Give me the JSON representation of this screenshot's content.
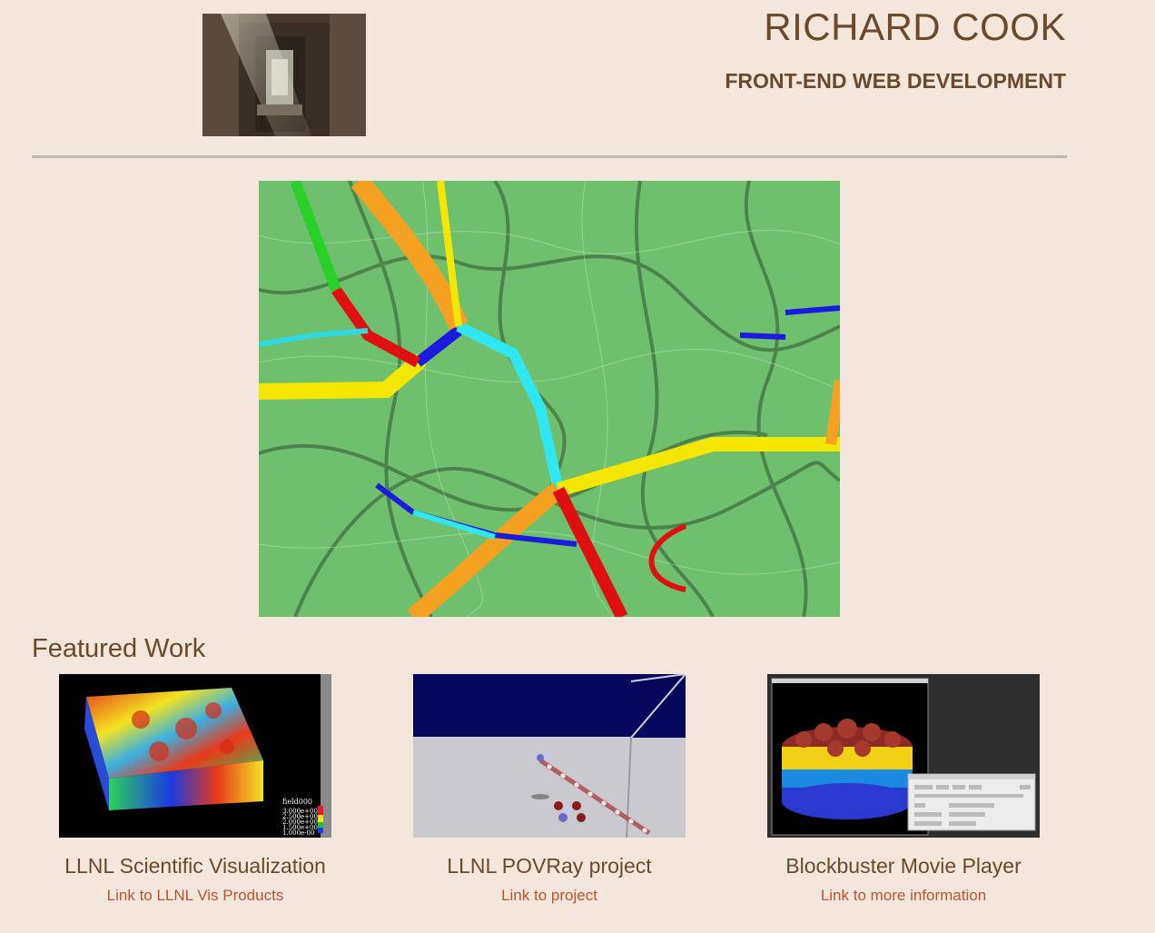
{
  "header": {
    "name": "RICHARD COOK",
    "subtitle": "FRONT-END WEB DEVELOPMENT"
  },
  "featured": {
    "heading": "Featured Work",
    "items": [
      {
        "title": "LLNL Scientific Visualization",
        "link": "Link to LLNL Vis Products",
        "legend_title": "field000",
        "legend_values": [
          "3.000e+00",
          "2.500e+00",
          "2.000e+00",
          "1.500e+00",
          "1.000e-00"
        ]
      },
      {
        "title": "LLNL POVRay project",
        "link": "Link to project"
      },
      {
        "title": "Blockbuster Movie Player",
        "link": "Link to more information"
      }
    ]
  },
  "colors": {
    "background": "#f2e6dd",
    "text": "#6b4a2a",
    "link": "#c0532a",
    "divider": "#bdb8b8"
  }
}
